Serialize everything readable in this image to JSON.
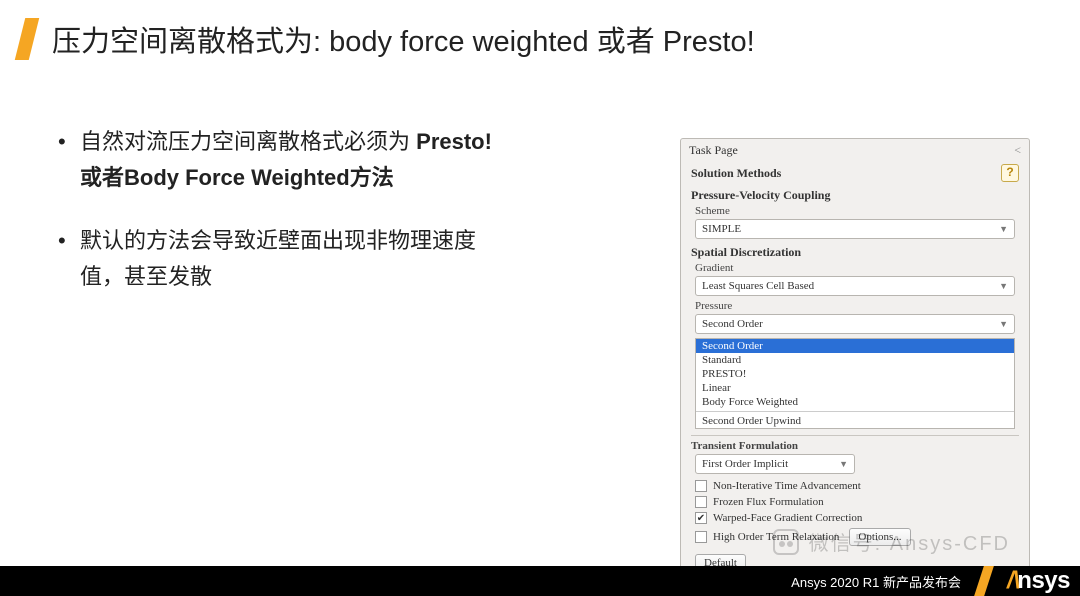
{
  "slide": {
    "title": "压力空间离散格式为: body force weighted 或者 Presto!",
    "bullets": [
      {
        "pre": "自然对流压力空间离散格式必须为",
        "strong": "Presto!或者Body Force Weighted方法",
        "post": ""
      },
      {
        "pre": "默认的方法会导致近壁面出现非物理速度值，甚至发散",
        "strong": "",
        "post": ""
      }
    ]
  },
  "panel": {
    "header": "Task Page",
    "title": "Solution Methods",
    "help": "?",
    "pvc": {
      "label": "Pressure-Velocity Coupling",
      "scheme_label": "Scheme",
      "scheme_value": "SIMPLE"
    },
    "sd": {
      "label": "Spatial Discretization",
      "gradient_label": "Gradient",
      "gradient_value": "Least Squares Cell Based",
      "pressure_label": "Pressure",
      "pressure_value": "Second Order",
      "pressure_options": [
        "Second Order",
        "Standard",
        "PRESTO!",
        "Linear",
        "Body Force Weighted",
        "Second Order Upwind"
      ]
    },
    "transient": {
      "label": "Transient Formulation",
      "value": "First Order Implicit"
    },
    "checks": {
      "non_iter": "Non-Iterative Time Advancement",
      "frozen": "Frozen Flux Formulation",
      "warped": "Warped-Face Gradient Correction",
      "hot": "High Order Term Relaxation"
    },
    "options_btn": "Options...",
    "default_btn": "Default"
  },
  "footer": {
    "text": "Ansys 2020 R1 新产品发布会",
    "logo": "nsys"
  },
  "watermark": "微信号: Ansys-CFD"
}
